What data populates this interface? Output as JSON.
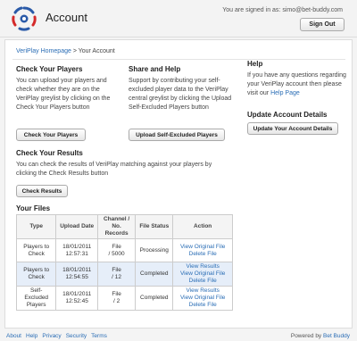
{
  "header": {
    "title": "Account",
    "signed_in_prefix": "You are signed in as: ",
    "user_email": "simo@bet-buddy.com",
    "sign_out_label": "Sign Out"
  },
  "breadcrumb": {
    "home": "VeriPlay Homepage",
    "separator": " > ",
    "current": "Your Account"
  },
  "check_players": {
    "heading": "Check Your Players",
    "text": "You can upload your players and check whether they are on the VeriPlay greylist by clicking on the Check Your Players button",
    "button": "Check Your Players"
  },
  "share_help": {
    "heading": "Share and Help",
    "text": "Support by contributing your self-excluded player data to the VeriPlay central greylist by clicking the Upload Self-Excluded Players button",
    "button": "Upload Self-Excluded Players"
  },
  "help": {
    "heading": "Help",
    "text": "If you have any questions regarding your VeriPlay account then please visit our ",
    "link": "Help Page"
  },
  "update_account": {
    "heading": "Update Account Details",
    "button": "Update Your Account Details"
  },
  "check_results": {
    "heading": "Check Your Results",
    "text": "You can check the results of VeriPlay matching against your players by clicking the Check Results button",
    "button": "Check Results"
  },
  "files": {
    "heading": "Your Files",
    "columns": [
      "Type",
      "Upload Date",
      "Channel / No. Records",
      "File Status",
      "Action"
    ],
    "rows": [
      {
        "type": "Players to Check",
        "date": "18/01/2011",
        "time": "12:57:31",
        "channel": "File",
        "records": "/ 5000",
        "status": "Processing",
        "actions": [
          "View Original File",
          "Delete File"
        ]
      },
      {
        "type": "Players to Check",
        "date": "18/01/2011",
        "time": "12:54:55",
        "channel": "File",
        "records": "/ 12",
        "status": "Completed",
        "actions": [
          "View Results",
          "View Original File",
          "Delete File"
        ]
      },
      {
        "type": "Self-Excluded Players",
        "date": "18/01/2011",
        "time": "12:52:45",
        "channel": "File",
        "records": "/ 2",
        "status": "Completed",
        "actions": [
          "View Results",
          "View Original File",
          "Delete File"
        ]
      }
    ]
  },
  "footer": {
    "links": [
      "About",
      "Help",
      "Privacy",
      "Security",
      "Terms"
    ],
    "powered_prefix": "Powered by ",
    "powered_brand": "Bet Buddy"
  },
  "colors": {
    "link": "#2a6db5",
    "logo_red": "#d42a2a",
    "logo_blue": "#2a5aa8",
    "highlight_row": "#e6eef9"
  }
}
